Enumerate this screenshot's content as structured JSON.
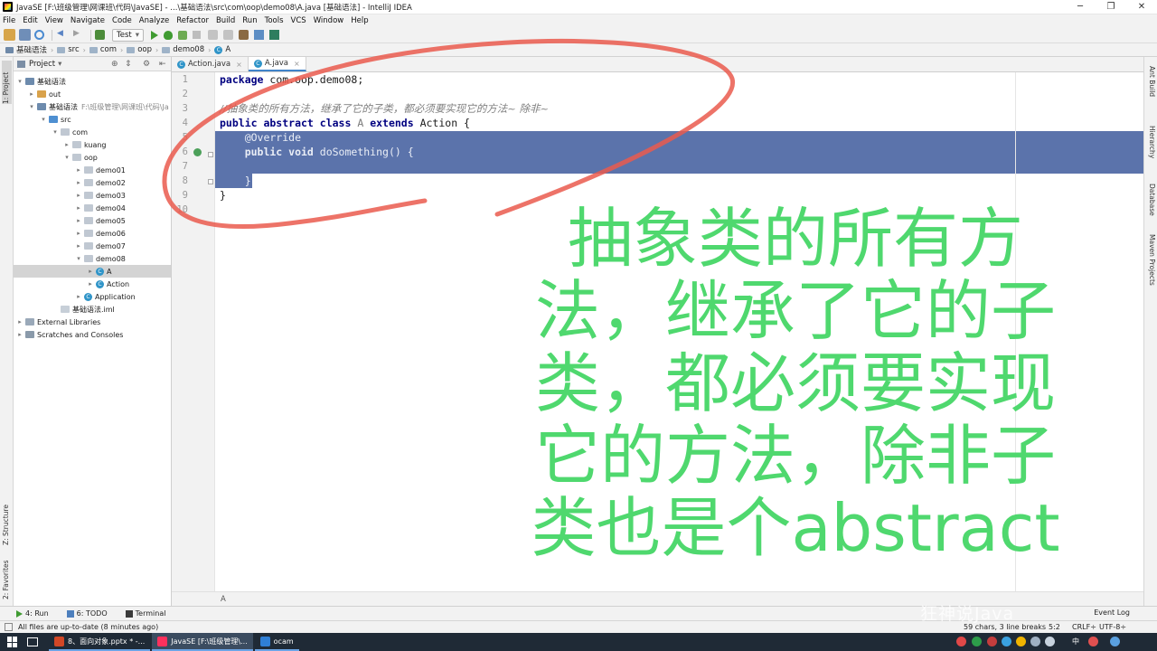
{
  "window": {
    "title": "JavaSE [F:\\班级管理\\网课班\\代码\\JavaSE] - ...\\基础语法\\src\\com\\oop\\demo08\\A.java [基础语法] - IntelliJ IDEA",
    "minimize": "─",
    "restore": "❐",
    "close": "✕"
  },
  "menu": [
    "File",
    "Edit",
    "View",
    "Navigate",
    "Code",
    "Analyze",
    "Refactor",
    "Build",
    "Run",
    "Tools",
    "VCS",
    "Window",
    "Help"
  ],
  "toolbar": {
    "run_config": "Test",
    "dropdown_arrow": "▾"
  },
  "breadcrumbs": [
    "基础语法",
    "src",
    "com",
    "oop",
    "demo08",
    "A"
  ],
  "left_tools": {
    "project": "1: Project",
    "structure": "Z: Structure",
    "favorites": "2: Favorites"
  },
  "project": {
    "header": "Project",
    "tree": [
      {
        "label": "基础语法",
        "hint": "",
        "level": 0,
        "toggle": "▾",
        "icon": "mod"
      },
      {
        "label": "out",
        "hint": "",
        "level": 1,
        "toggle": "▸",
        "icon": "orange"
      },
      {
        "label": "基础语法",
        "hint": "F:\\班级管理\\网课班\\代码\\Ja",
        "level": 1,
        "toggle": "▾",
        "icon": "mod"
      },
      {
        "label": "src",
        "hint": "",
        "level": 2,
        "toggle": "▾",
        "icon": "src"
      },
      {
        "label": "com",
        "hint": "",
        "level": 3,
        "toggle": "▾",
        "icon": "pkg"
      },
      {
        "label": "kuang",
        "hint": "",
        "level": 4,
        "toggle": "▸",
        "icon": "pkg"
      },
      {
        "label": "oop",
        "hint": "",
        "level": 4,
        "toggle": "▾",
        "icon": "pkg"
      },
      {
        "label": "demo01",
        "hint": "",
        "level": 5,
        "toggle": "▸",
        "icon": "pkg"
      },
      {
        "label": "demo02",
        "hint": "",
        "level": 5,
        "toggle": "▸",
        "icon": "pkg"
      },
      {
        "label": "demo03",
        "hint": "",
        "level": 5,
        "toggle": "▸",
        "icon": "pkg"
      },
      {
        "label": "demo04",
        "hint": "",
        "level": 5,
        "toggle": "▸",
        "icon": "pkg"
      },
      {
        "label": "demo05",
        "hint": "",
        "level": 5,
        "toggle": "▸",
        "icon": "pkg"
      },
      {
        "label": "demo06",
        "hint": "",
        "level": 5,
        "toggle": "▸",
        "icon": "pkg"
      },
      {
        "label": "demo07",
        "hint": "",
        "level": 5,
        "toggle": "▸",
        "icon": "pkg"
      },
      {
        "label": "demo08",
        "hint": "",
        "level": 5,
        "toggle": "▾",
        "icon": "pkg"
      },
      {
        "label": "A",
        "hint": "",
        "level": 6,
        "toggle": "▸",
        "icon": "cls",
        "selected": true
      },
      {
        "label": "Action",
        "hint": "",
        "level": 6,
        "toggle": "▸",
        "icon": "cls"
      },
      {
        "label": "Application",
        "hint": "",
        "level": 5,
        "toggle": "▸",
        "icon": "cls"
      },
      {
        "label": "基础语法.iml",
        "hint": "",
        "level": 3,
        "toggle": "",
        "icon": "iml"
      },
      {
        "label": "External Libraries",
        "hint": "",
        "level": 0,
        "toggle": "▸",
        "icon": "lib"
      },
      {
        "label": "Scratches and Consoles",
        "hint": "",
        "level": 0,
        "toggle": "▸",
        "icon": "scr"
      }
    ]
  },
  "tabs": [
    {
      "label": "Action.java",
      "active": false
    },
    {
      "label": "A.java",
      "active": true
    }
  ],
  "code": {
    "line_numbers": [
      "1",
      "2",
      "3",
      "4",
      "5",
      "6",
      "7",
      "8",
      "9",
      "10"
    ],
    "line1": {
      "kw": "package",
      "rest": " com.oop.demo08;"
    },
    "line3": "//抽象类的所有方法，继承了它的子类，都必须要实现它的方法~ 除非~",
    "line4": {
      "kw1": "public abstract class",
      "cls": " A ",
      "kw2": "extends",
      "rest": " Action {"
    },
    "line5": "    @Override",
    "line6": {
      "kw": "    public void",
      "rest": " doSomething() {"
    },
    "line8": "    }",
    "line9": "}",
    "bottom_crumb": "A"
  },
  "right_tools": [
    "Ant Build",
    "Hierarchy",
    "Database",
    "Maven Projects"
  ],
  "bottom_tabs": [
    {
      "label": "4: Run",
      "icon": "run"
    },
    {
      "label": "6: TODO",
      "icon": "todo"
    },
    {
      "label": "Terminal",
      "icon": "term"
    }
  ],
  "event_log": "Event Log",
  "status": {
    "message": "All files are up-to-date (8 minutes ago)",
    "chars": "59 chars, 3 line breaks",
    "pos": "5:2",
    "crlf": "CRLF÷",
    "enc": "UTF-8÷"
  },
  "taskbar": {
    "tasks": [
      {
        "label": "8、面向对象.pptx * -...",
        "active": false
      },
      {
        "label": "JavaSE [F:\\班级管理\\...",
        "active": true
      },
      {
        "label": "ocam",
        "active": false
      }
    ],
    "ime": "中"
  },
  "overlay_text": "抽象类的所有方法，继承了它的子类，都必须要实现它的方法，除非子类也是个abstract",
  "watermark": "狂神说Java"
}
